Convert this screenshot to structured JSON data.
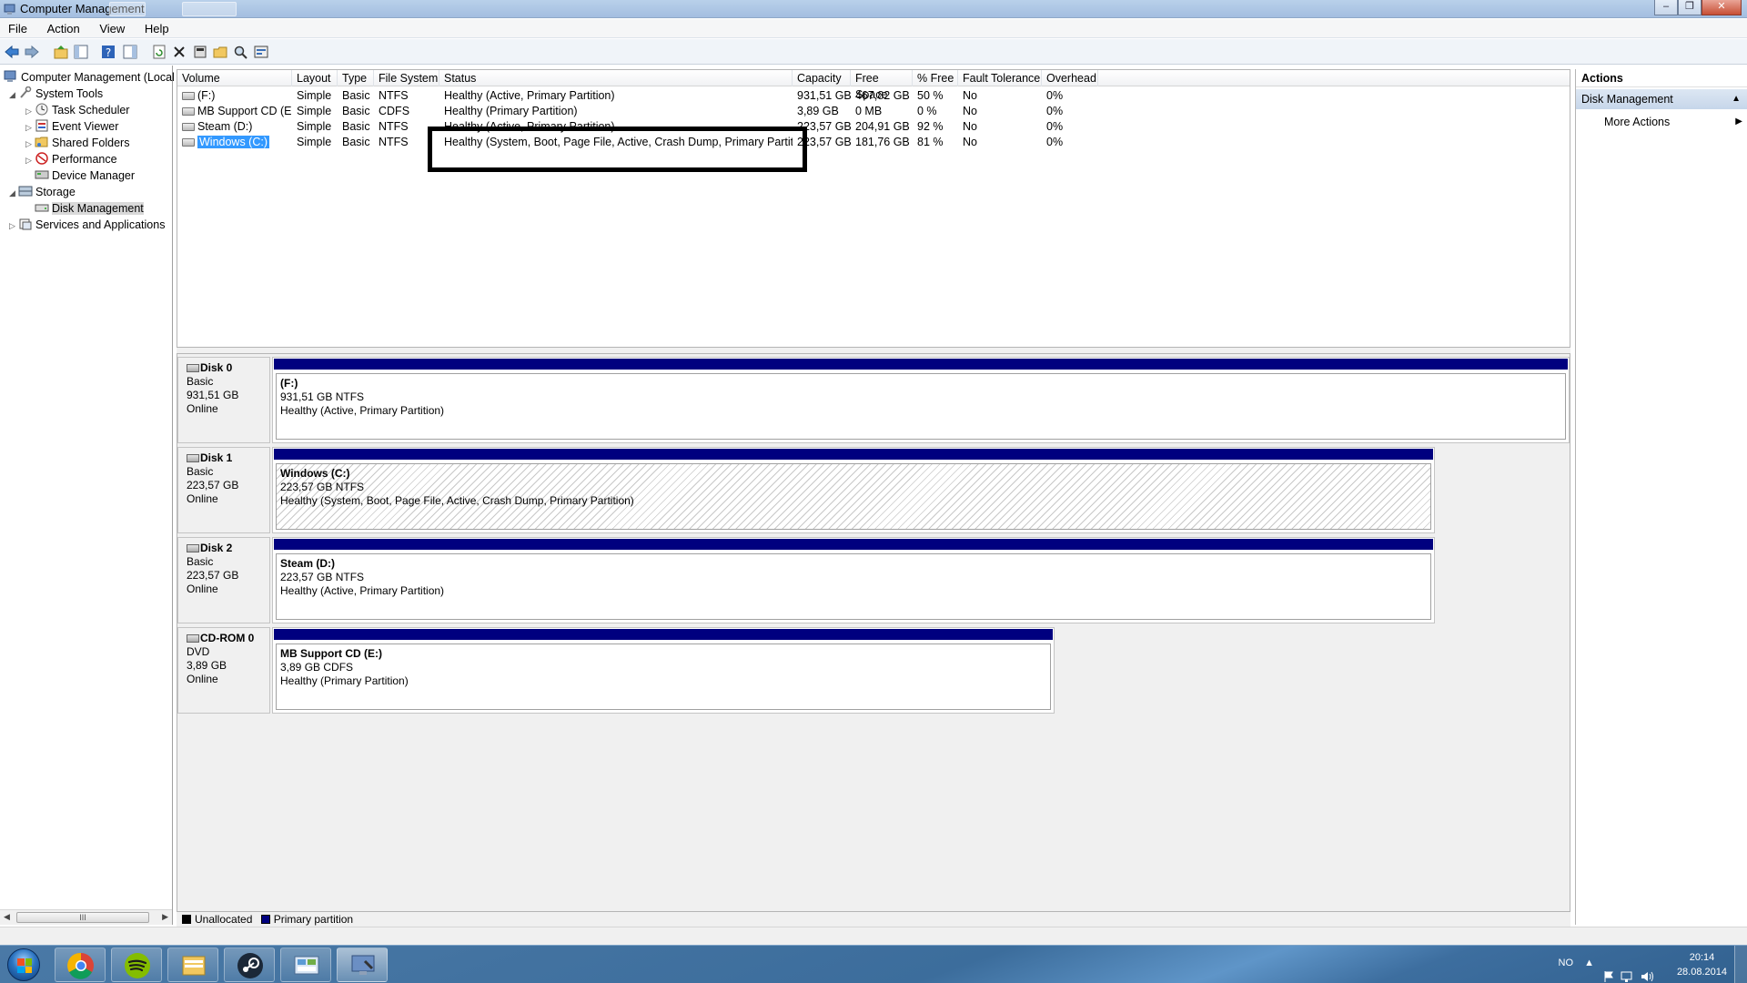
{
  "window": {
    "title": "Computer Management",
    "controls": {
      "minimize": "‒",
      "maximize": "❐",
      "close": "✕"
    }
  },
  "menu": [
    "File",
    "Action",
    "View",
    "Help"
  ],
  "tree": {
    "root": "Computer Management (Local",
    "items": [
      {
        "label": "System Tools",
        "level": 1,
        "expanded": true,
        "icon": "system-tools-icon"
      },
      {
        "label": "Task Scheduler",
        "level": 2,
        "icon": "task-scheduler-icon"
      },
      {
        "label": "Event Viewer",
        "level": 2,
        "icon": "event-viewer-icon"
      },
      {
        "label": "Shared Folders",
        "level": 2,
        "icon": "shared-folders-icon"
      },
      {
        "label": "Performance",
        "level": 2,
        "icon": "performance-icon"
      },
      {
        "label": "Device Manager",
        "level": 2,
        "icon": "device-manager-icon"
      },
      {
        "label": "Storage",
        "level": 1,
        "expanded": true,
        "icon": "storage-icon"
      },
      {
        "label": "Disk Management",
        "level": 2,
        "selected": true,
        "icon": "disk-management-icon"
      },
      {
        "label": "Services and Applications",
        "level": 1,
        "icon": "services-icon"
      }
    ],
    "scroll_thumb": "III"
  },
  "volume_list": {
    "columns": [
      "Volume",
      "Layout",
      "Type",
      "File System",
      "Status",
      "Capacity",
      "Free Space",
      "% Free",
      "Fault Tolerance",
      "Overhead"
    ],
    "rows": [
      {
        "volume": "(F:)",
        "layout": "Simple",
        "type": "Basic",
        "fs": "NTFS",
        "status": "Healthy (Active, Primary Partition)",
        "capacity": "931,51 GB",
        "free": "467,82 GB",
        "pct": "50 %",
        "fault": "No",
        "overhead": "0%"
      },
      {
        "volume": "MB Support CD (E:)",
        "layout": "Simple",
        "type": "Basic",
        "fs": "CDFS",
        "status": "Healthy (Primary Partition)",
        "capacity": "3,89 GB",
        "free": "0 MB",
        "pct": "0 %",
        "fault": "No",
        "overhead": "0%"
      },
      {
        "volume": "Steam (D:)",
        "layout": "Simple",
        "type": "Basic",
        "fs": "NTFS",
        "status": "Healthy (Active, Primary Partition)",
        "capacity": "223,57 GB",
        "free": "204,91 GB",
        "pct": "92 %",
        "fault": "No",
        "overhead": "0%"
      },
      {
        "volume": "Windows (C:)",
        "layout": "Simple",
        "type": "Basic",
        "fs": "NTFS",
        "status": "Healthy (System, Boot, Page File, Active, Crash Dump, Primary Partition)",
        "capacity": "223,57 GB",
        "free": "181,76 GB",
        "pct": "81 %",
        "fault": "No",
        "overhead": "0%",
        "selected": true
      }
    ]
  },
  "disks": [
    {
      "name": "Disk 0",
      "type": "Basic",
      "size": "931,51 GB",
      "state": "Online",
      "partition": {
        "name": "(F:)",
        "size_fs": "931,51 GB NTFS",
        "status": "Healthy (Active, Primary Partition)"
      }
    },
    {
      "name": "Disk 1",
      "type": "Basic",
      "size": "223,57 GB",
      "state": "Online",
      "partition": {
        "name": "Windows  (C:)",
        "size_fs": "223,57 GB NTFS",
        "status": "Healthy (System, Boot, Page File, Active, Crash Dump, Primary Partition)"
      }
    },
    {
      "name": "Disk 2",
      "type": "Basic",
      "size": "223,57 GB",
      "state": "Online",
      "partition": {
        "name": "Steam  (D:)",
        "size_fs": "223,57 GB NTFS",
        "status": "Healthy (Active, Primary Partition)"
      }
    },
    {
      "name": "CD-ROM 0",
      "type": "DVD",
      "size": "3,89 GB",
      "state": "Online",
      "partition": {
        "name": "MB Support CD  (E:)",
        "size_fs": "3,89 GB CDFS",
        "status": "Healthy (Primary Partition)"
      }
    }
  ],
  "legend": {
    "unallocated": "Unallocated",
    "primary": "Primary partition",
    "colors": {
      "unallocated": "#000000",
      "primary": "#00007f"
    }
  },
  "actions": {
    "header": "Actions",
    "section": "Disk Management",
    "item": "More Actions"
  },
  "taskbar": {
    "apps": [
      "chrome-icon",
      "spotify-icon",
      "explorer-icon",
      "steam-icon",
      "control-panel-icon",
      "computer-management-icon"
    ],
    "language": "NO",
    "time": "20:14",
    "date": "28.08.2014"
  },
  "colors": {
    "selection": "#3399ff",
    "partition_bar": "#00007f",
    "titlebar": "#b9d1ea"
  }
}
